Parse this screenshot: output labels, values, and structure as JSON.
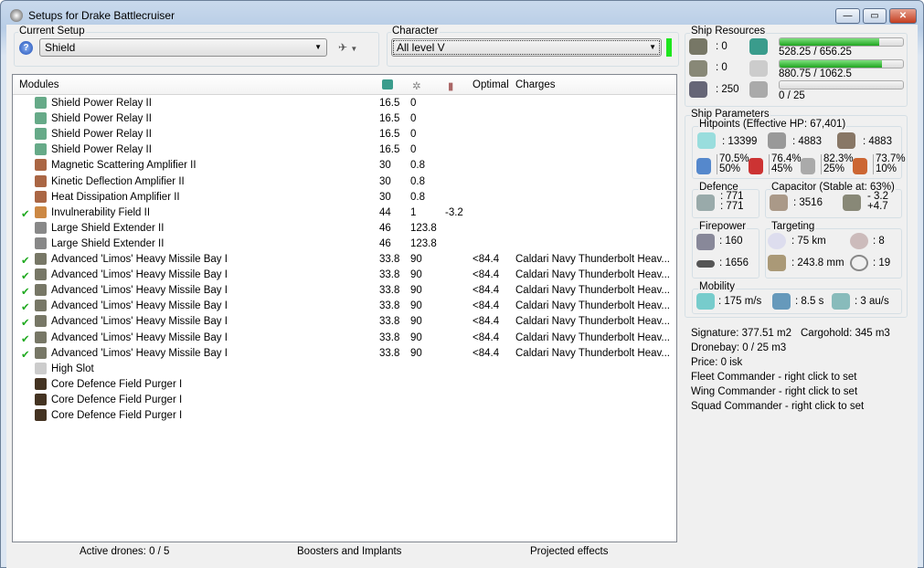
{
  "window": {
    "title": "Setups for Drake Battlecruiser",
    "min": "—",
    "max": "▭",
    "close": "✕"
  },
  "setup": {
    "label": "Current Setup",
    "value": "Shield"
  },
  "character": {
    "label": "Character",
    "value": "All level V",
    "status_color": "#1ee61e"
  },
  "modules": {
    "columns": [
      "Modules",
      "Optimal",
      "Charges"
    ],
    "rows": [
      {
        "check": false,
        "icon": "shield-relay",
        "name": "Shield Power Relay II",
        "cpu": "16.5",
        "power": "0",
        "cap": "",
        "optimal": "",
        "charges": ""
      },
      {
        "check": false,
        "icon": "shield-relay",
        "name": "Shield Power Relay II",
        "cpu": "16.5",
        "power": "0",
        "cap": "",
        "optimal": "",
        "charges": ""
      },
      {
        "check": false,
        "icon": "shield-relay",
        "name": "Shield Power Relay II",
        "cpu": "16.5",
        "power": "0",
        "cap": "",
        "optimal": "",
        "charges": ""
      },
      {
        "check": false,
        "icon": "shield-relay",
        "name": "Shield Power Relay II",
        "cpu": "16.5",
        "power": "0",
        "cap": "",
        "optimal": "",
        "charges": ""
      },
      {
        "check": false,
        "icon": "amplifier",
        "name": "Magnetic Scattering Amplifier II",
        "cpu": "30",
        "power": "0.8",
        "cap": "",
        "optimal": "",
        "charges": ""
      },
      {
        "check": false,
        "icon": "amplifier",
        "name": "Kinetic Deflection Amplifier II",
        "cpu": "30",
        "power": "0.8",
        "cap": "",
        "optimal": "",
        "charges": ""
      },
      {
        "check": false,
        "icon": "amplifier",
        "name": "Heat Dissipation Amplifier II",
        "cpu": "30",
        "power": "0.8",
        "cap": "",
        "optimal": "",
        "charges": ""
      },
      {
        "check": true,
        "icon": "invuln",
        "name": "Invulnerability Field II",
        "cpu": "44",
        "power": "1",
        "cap": "-3.2",
        "optimal": "",
        "charges": ""
      },
      {
        "check": false,
        "icon": "extender",
        "name": "Large Shield Extender II",
        "cpu": "46",
        "power": "123.8",
        "cap": "",
        "optimal": "",
        "charges": ""
      },
      {
        "check": false,
        "icon": "extender",
        "name": "Large Shield Extender II",
        "cpu": "46",
        "power": "123.8",
        "cap": "",
        "optimal": "",
        "charges": ""
      },
      {
        "check": true,
        "icon": "launcher",
        "name": "Advanced 'Limos' Heavy Missile Bay I",
        "cpu": "33.8",
        "power": "90",
        "cap": "",
        "optimal": "<84.4",
        "charges": "Caldari Navy Thunderbolt Heav..."
      },
      {
        "check": true,
        "icon": "launcher",
        "name": "Advanced 'Limos' Heavy Missile Bay I",
        "cpu": "33.8",
        "power": "90",
        "cap": "",
        "optimal": "<84.4",
        "charges": "Caldari Navy Thunderbolt Heav..."
      },
      {
        "check": true,
        "icon": "launcher",
        "name": "Advanced 'Limos' Heavy Missile Bay I",
        "cpu": "33.8",
        "power": "90",
        "cap": "",
        "optimal": "<84.4",
        "charges": "Caldari Navy Thunderbolt Heav..."
      },
      {
        "check": true,
        "icon": "launcher",
        "name": "Advanced 'Limos' Heavy Missile Bay I",
        "cpu": "33.8",
        "power": "90",
        "cap": "",
        "optimal": "<84.4",
        "charges": "Caldari Navy Thunderbolt Heav..."
      },
      {
        "check": true,
        "icon": "launcher",
        "name": "Advanced 'Limos' Heavy Missile Bay I",
        "cpu": "33.8",
        "power": "90",
        "cap": "",
        "optimal": "<84.4",
        "charges": "Caldari Navy Thunderbolt Heav..."
      },
      {
        "check": true,
        "icon": "launcher",
        "name": "Advanced 'Limos' Heavy Missile Bay I",
        "cpu": "33.8",
        "power": "90",
        "cap": "",
        "optimal": "<84.4",
        "charges": "Caldari Navy Thunderbolt Heav..."
      },
      {
        "check": true,
        "icon": "launcher",
        "name": "Advanced 'Limos' Heavy Missile Bay I",
        "cpu": "33.8",
        "power": "90",
        "cap": "",
        "optimal": "<84.4",
        "charges": "Caldari Navy Thunderbolt Heav..."
      },
      {
        "check": false,
        "icon": "highslot",
        "name": "High Slot",
        "cpu": "",
        "power": "",
        "cap": "",
        "optimal": "",
        "charges": ""
      },
      {
        "check": false,
        "icon": "rig",
        "name": "Core Defence Field Purger I",
        "cpu": "",
        "power": "",
        "cap": "",
        "optimal": "",
        "charges": ""
      },
      {
        "check": false,
        "icon": "rig",
        "name": "Core Defence Field Purger I",
        "cpu": "",
        "power": "",
        "cap": "",
        "optimal": "",
        "charges": ""
      },
      {
        "check": false,
        "icon": "rig",
        "name": "Core Defence Field Purger I",
        "cpu": "",
        "power": "",
        "cap": "",
        "optimal": "",
        "charges": ""
      }
    ]
  },
  "status": {
    "drones": "Active drones: 0 / 5",
    "boosters": "Boosters and Implants",
    "projected": "Projected effects"
  },
  "resources": {
    "label": "Ship Resources",
    "turrets": ": 0",
    "launchers": ": 0",
    "calibration": ": 250",
    "cpu": {
      "text": "528.25 / 656.25",
      "fraction": 0.805
    },
    "power": {
      "text": "880.75 / 1062.5",
      "fraction": 0.829
    },
    "drone_bw": {
      "text": "0 / 25",
      "fraction": 0
    }
  },
  "params": {
    "label": "Ship Parameters",
    "hp": {
      "label": "Hitpoints (Effective HP: 67,401)",
      "shield": ": 13399",
      "armor": ": 4883",
      "structure": ": 4883",
      "resists": [
        [
          "70.5%",
          "50%"
        ],
        [
          "76.4%",
          "45%"
        ],
        [
          "82.3%",
          "25%"
        ],
        [
          "73.7%",
          "10%"
        ]
      ]
    },
    "defence": {
      "label": "Defence",
      "a": ": 771",
      "b": ": 771"
    },
    "capacitor": {
      "label": "Capacitor (Stable at: 63%)",
      "cap": ": 3516",
      "use": "- 3.2",
      "recharge": "+4.7"
    },
    "firepower": {
      "label": "Firepower",
      "dps": ": 160",
      "volley": ": 1656"
    },
    "targeting": {
      "label": "Targeting",
      "range": ": 75 km",
      "targets": ": 8",
      "scan_res": ": 243.8 mm",
      "sensor": ": 19"
    },
    "mobility": {
      "label": "Mobility",
      "speed": ": 175 m/s",
      "align": ": 8.5 s",
      "warp": ": 3 au/s"
    },
    "misc": [
      "Signature: 377.51 m2",
      "Cargohold: 345 m3",
      "Dronebay: 0 / 25 m3",
      "Price: 0 isk",
      "Fleet Commander - right click to set",
      "Wing Commander - right click to set",
      "Squad Commander - right click to set"
    ]
  }
}
